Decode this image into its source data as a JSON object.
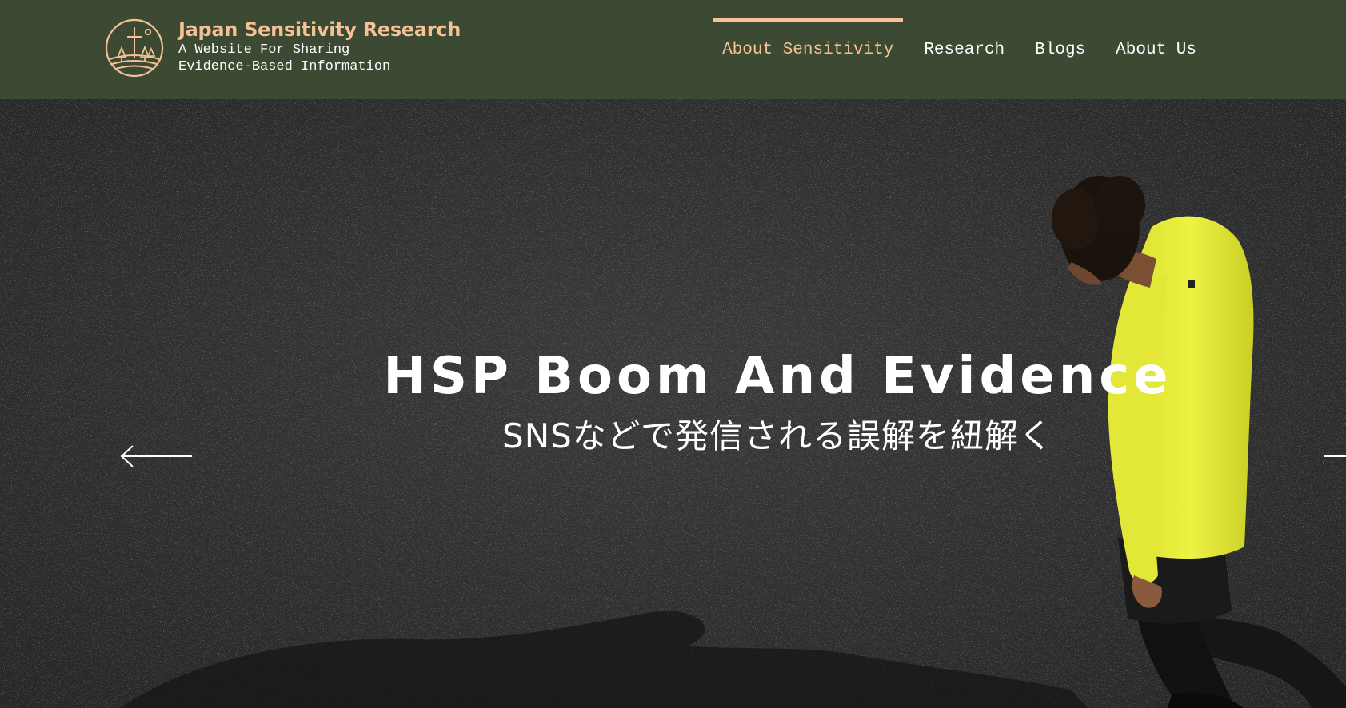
{
  "site": {
    "title": "Japan Sensitivity Research",
    "tagline_line1": "A Website For Sharing",
    "tagline_line2": "Evidence-Based Information"
  },
  "nav": {
    "items": [
      {
        "label": "About Sensitivity",
        "active": true
      },
      {
        "label": "Research",
        "active": false
      },
      {
        "label": "Blogs",
        "active": false
      },
      {
        "label": "About Us",
        "active": false
      }
    ]
  },
  "hero": {
    "title": "HSP Boom And Evidence",
    "subtitle": "SNSなどで発信される誤解を紐解く"
  },
  "icons": {
    "logo": "landscape-logo-icon",
    "prev": "arrow-left-icon",
    "next": "arrow-right-icon"
  },
  "colors": {
    "header_bg": "#3c4a34",
    "accent": "#f5c195",
    "hero_bg": "#2d2d2d",
    "jacket": "#e9ee3c"
  }
}
